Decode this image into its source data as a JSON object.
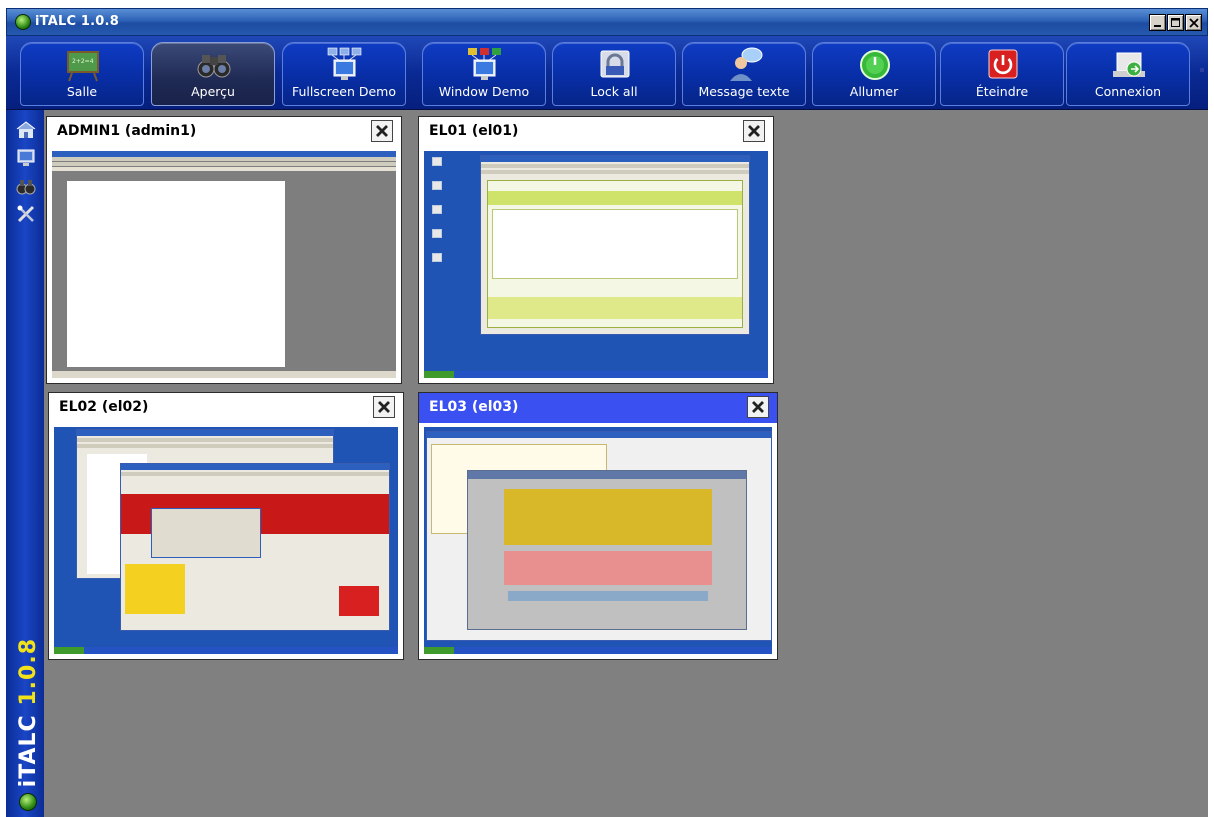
{
  "window": {
    "title": "iTALC 1.0.8"
  },
  "toolbar": {
    "buttons": [
      {
        "label": "Salle",
        "icon": "classroom-icon"
      },
      {
        "label": "Aperçu",
        "icon": "binoculars-icon"
      },
      {
        "label": "Fullscreen Demo",
        "icon": "fullscreen-demo-icon"
      },
      {
        "label": "Window Demo",
        "icon": "window-demo-icon"
      },
      {
        "label": "Lock all",
        "icon": "lock-icon"
      },
      {
        "label": "Message texte",
        "icon": "message-icon"
      },
      {
        "label": "Allumer",
        "icon": "power-on-icon"
      },
      {
        "label": "Éteindre",
        "icon": "power-off-icon"
      },
      {
        "label": "Connexion",
        "icon": "login-icon"
      }
    ],
    "active": "Aperçu"
  },
  "sidebar": {
    "icons": [
      "home-icon",
      "monitor-icon",
      "binoculars-icon",
      "tools-icon"
    ],
    "brand": "iTALC",
    "brand_version": "1.0.8"
  },
  "clients": [
    {
      "name": "ADMIN1 (admin1)",
      "selected": false
    },
    {
      "name": "EL01 (el01)",
      "selected": false
    },
    {
      "name": "EL02 (el02)",
      "selected": false
    },
    {
      "name": "EL03 (el03)",
      "selected": true
    }
  ],
  "colors": {
    "toolbar_blue": "#082ea6",
    "workspace_gray": "#808080",
    "selected_header": "#3b50f0",
    "desktop_blue": "#1f54b4",
    "form_green": "#cfe36a"
  }
}
